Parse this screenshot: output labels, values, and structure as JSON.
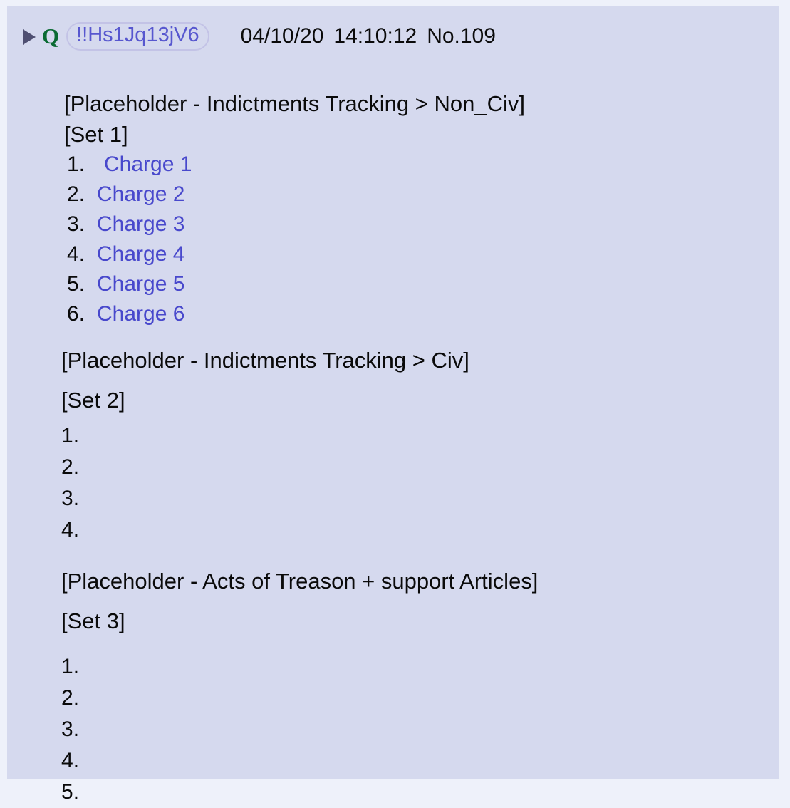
{
  "post": {
    "expand_icon": "triangle-right-icon",
    "author_name": "Q",
    "tripcode": "!!Hs1Jq13jV6",
    "date": "04/10/20",
    "time": "14:10:12",
    "post_number": "No.109"
  },
  "colors": {
    "page_background": "#eef1fa",
    "post_background": "#d5d9ee",
    "author_name": "#0b6b33",
    "tripcode": "#5757cf",
    "tripcode_border": "#c3c3e6",
    "expand_arrow": "#4f4f71",
    "body_text": "#0a0a0a",
    "link": "#4848cc"
  },
  "sections": [
    {
      "placeholder": "[Placeholder - Indictments Tracking > Non_Civ]",
      "set_label": "[Set 1]",
      "items": [
        {
          "number": "1.",
          "label": "Charge 1"
        },
        {
          "number": "2.",
          "label": "Charge 2"
        },
        {
          "number": "3.",
          "label": "Charge 3"
        },
        {
          "number": "4.",
          "label": "Charge 4"
        },
        {
          "number": "5.",
          "label": "Charge 5"
        },
        {
          "number": "6.",
          "label": "Charge 6"
        }
      ]
    },
    {
      "placeholder": "[Placeholder - Indictments Tracking > Civ]",
      "set_label": "[Set 2]",
      "items": [
        {
          "number": "1.",
          "label": ""
        },
        {
          "number": "2.",
          "label": ""
        },
        {
          "number": "3.",
          "label": ""
        },
        {
          "number": "4.",
          "label": ""
        }
      ]
    },
    {
      "placeholder": "[Placeholder - Acts of Treason + support Articles]",
      "set_label": "[Set 3]",
      "items": [
        {
          "number": "1.",
          "label": ""
        },
        {
          "number": "2.",
          "label": ""
        },
        {
          "number": "3.",
          "label": ""
        },
        {
          "number": "4.",
          "label": ""
        },
        {
          "number": "5.",
          "label": ""
        }
      ]
    }
  ]
}
